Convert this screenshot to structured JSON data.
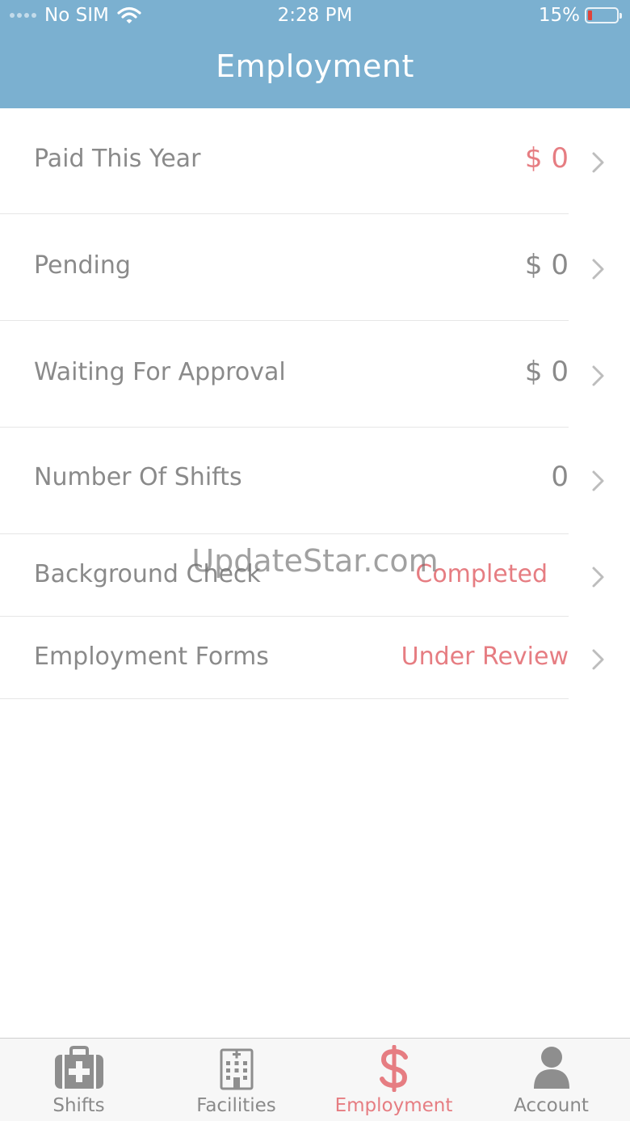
{
  "status_bar": {
    "carrier": "No SIM",
    "time": "2:28 PM",
    "battery": "15%",
    "battery_level": 0.15
  },
  "header": {
    "title": "Employment"
  },
  "rows": [
    {
      "label": "Paid This Year",
      "value": "$ 0",
      "value_color": "#e67d82"
    },
    {
      "label": "Pending",
      "value": "$ 0",
      "value_color": "#8a8a8a"
    },
    {
      "label": "Waiting For Approval",
      "value": "$ 0",
      "value_color": "#8a8a8a"
    },
    {
      "label": "Number Of Shifts",
      "value": "0",
      "value_color": "#8a8a8a"
    },
    {
      "label": "Background Check",
      "value": "Completed",
      "value_color": "#e67d82"
    },
    {
      "label": "Employment Forms",
      "value": "Under Review",
      "value_color": "#e67d82"
    }
  ],
  "watermark": "UpdateStar.com",
  "tabbar": {
    "tabs": [
      {
        "label": "Shifts",
        "icon": "medical-kit-icon",
        "active": false
      },
      {
        "label": "Facilities",
        "icon": "building-icon",
        "active": false
      },
      {
        "label": "Employment",
        "icon": "dollar-icon",
        "active": true
      },
      {
        "label": "Account",
        "icon": "person-icon",
        "active": false
      }
    ]
  },
  "colors": {
    "header_bg": "#7bb0d0",
    "accent": "#e67d82",
    "text_gray": "#8a8a8a"
  }
}
